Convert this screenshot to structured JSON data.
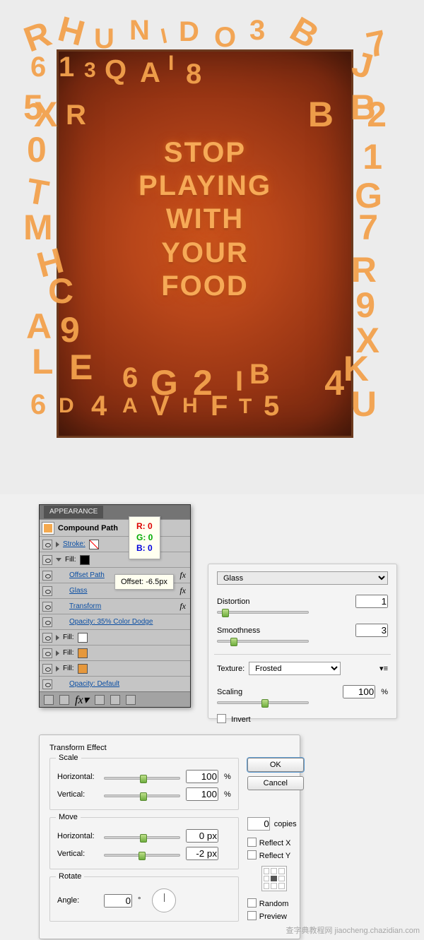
{
  "artwork": {
    "lines": [
      "STOP",
      "PLAYING",
      "WITH",
      "YOUR",
      "FOOD"
    ]
  },
  "appearance": {
    "panel_label": "APPEARANCE",
    "target": "Compound Path",
    "stroke_label": "Stroke:",
    "fill_label": "Fill:",
    "offset_path": "Offset Path",
    "glass": "Glass",
    "transform": "Transform",
    "opacity_fill": "Opacity: 35% Color Dodge",
    "opacity_default": "Opacity: Default"
  },
  "rgb_tooltip": {
    "r": "R: 0",
    "g": "G: 0",
    "b": "B: 0"
  },
  "offset_tip": "Offset: -6.5px",
  "glass_panel": {
    "preset": "Glass",
    "distortion_label": "Distortion",
    "distortion_value": "1",
    "smoothness_label": "Smoothness",
    "smoothness_value": "3",
    "texture_label": "Texture:",
    "texture_value": "Frosted",
    "scaling_label": "Scaling",
    "scaling_value": "100",
    "invert_label": "Invert"
  },
  "transform": {
    "title": "Transform Effect",
    "scale_legend": "Scale",
    "horizontal": "Horizontal:",
    "vertical": "Vertical:",
    "scale_h": "100",
    "scale_v": "100",
    "move_legend": "Move",
    "move_h": "0 px",
    "move_v": "-2 px",
    "rotate_legend": "Rotate",
    "angle_label": "Angle:",
    "angle_value": "0",
    "ok": "OK",
    "cancel": "Cancel",
    "copies_value": "0",
    "copies_label": "copies",
    "reflect_x": "Reflect X",
    "reflect_y": "Reflect Y",
    "random": "Random",
    "preview": "Preview"
  },
  "watermark": "查字典教程网  jiaocheng.chazidian.com"
}
